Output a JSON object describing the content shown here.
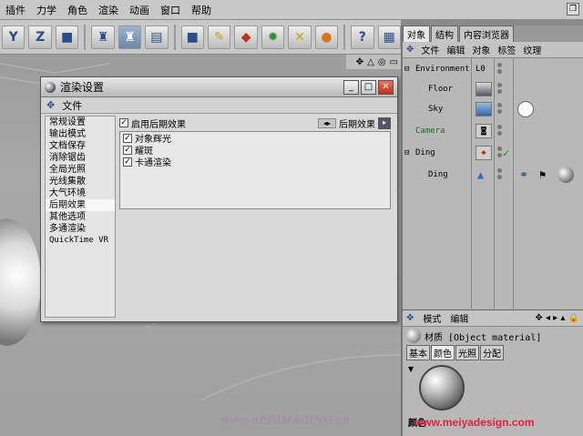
{
  "menubar": {
    "items": [
      "插件",
      "力学",
      "角色",
      "渲染",
      "动画",
      "窗口",
      "帮助"
    ]
  },
  "toolbar": {
    "icons": [
      "y-axis-icon",
      "z-axis-icon",
      "cube-icon",
      "camera-icon",
      "render-icon",
      "render-view-icon",
      "object-icon",
      "scene-icon",
      "deform-icon",
      "array-icon",
      "light-icon",
      "material-icon",
      "pointer-icon",
      "scene-settings-icon"
    ]
  },
  "dialog": {
    "title": "渲染设置",
    "menu_file": "文件",
    "categories": [
      "常规设置",
      "输出模式",
      "文档保存",
      "消除锯齿",
      "全局光照",
      "光线集散",
      "大气环境",
      "后期效果",
      "其他选项",
      "多通渲染",
      "QuickTime VR"
    ],
    "active_category": "后期效果",
    "enable_label": "启用后期效果",
    "effect_dropdown_label": "后期效果",
    "effects": [
      {
        "label": "对象辉光",
        "checked": true
      },
      {
        "label": "耀斑",
        "checked": true
      },
      {
        "label": "卡通渲染",
        "checked": true
      }
    ]
  },
  "object_manager": {
    "tabs": [
      "对象",
      "结构",
      "内容浏览器"
    ],
    "menu": [
      "文件",
      "编辑",
      "对象",
      "标签",
      "纹理"
    ],
    "objects": [
      {
        "name": "Environment",
        "icon": "L0"
      },
      {
        "name": "Floor",
        "icon": ""
      },
      {
        "name": "Sky",
        "icon": ""
      },
      {
        "name": "Camera",
        "icon": ""
      },
      {
        "name": "Ding",
        "icon": ""
      },
      {
        "name": "Ding",
        "icon": ""
      }
    ]
  },
  "attr_manager": {
    "menu_mode": "模式",
    "menu_edit": "编辑",
    "material_label": "材质 [Object material]",
    "tabs": [
      "基本",
      "颜色",
      "光照",
      "分配"
    ],
    "active_tab": "颜色",
    "section_label": "颜色"
  },
  "watermarks": {
    "left": "www.nEOIMAGING.cn",
    "right": "www.meiyadesign.com"
  }
}
